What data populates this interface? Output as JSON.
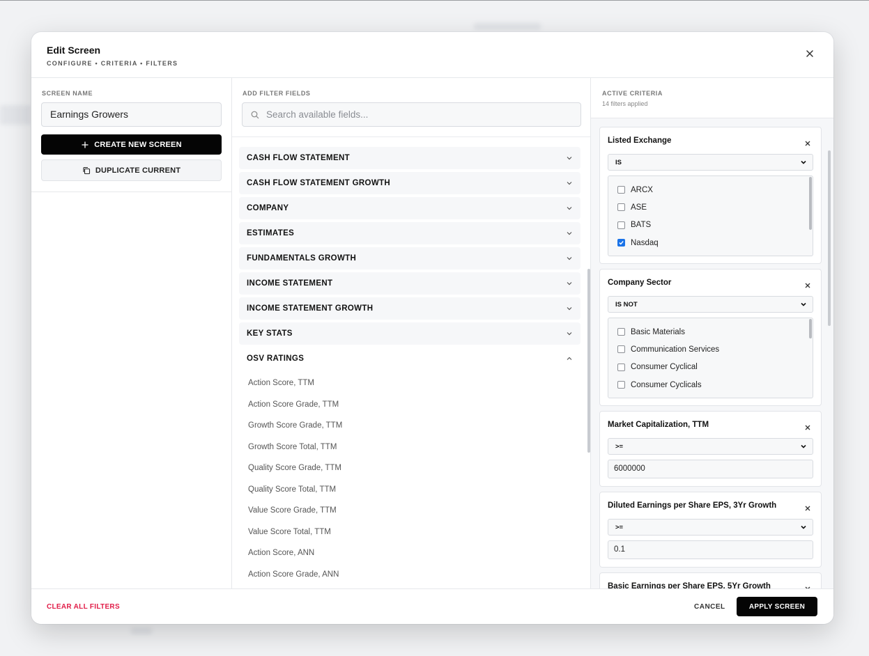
{
  "modal": {
    "title": "Edit Screen",
    "subtitle": "CONFIGURE • CRITERIA • FILTERS"
  },
  "left": {
    "label": "SCREEN NAME",
    "name_value": "Earnings Growers",
    "create_label": "CREATE NEW SCREEN",
    "duplicate_label": "DUPLICATE CURRENT"
  },
  "middle": {
    "label": "ADD FILTER FIELDS",
    "search_placeholder": "Search available fields...",
    "categories": [
      "CASH FLOW STATEMENT",
      "CASH FLOW STATEMENT GROWTH",
      "COMPANY",
      "ESTIMATES",
      "FUNDAMENTALS GROWTH",
      "INCOME STATEMENT",
      "INCOME STATEMENT GROWTH",
      "KEY STATS",
      "OSV RATINGS"
    ],
    "osv_fields": [
      "Action Score, TTM",
      "Action Score Grade, TTM",
      "Growth Score Grade, TTM",
      "Growth Score Total, TTM",
      "Quality Score Grade, TTM",
      "Quality Score Total, TTM",
      "Value Score Grade, TTM",
      "Value Score Total, TTM",
      "Action Score, ANN",
      "Action Score Grade, ANN"
    ]
  },
  "right": {
    "label": "ACTIVE CRITERIA",
    "count": "14 filters applied",
    "filters": [
      {
        "title": "Listed Exchange",
        "operator": "IS",
        "options": [
          {
            "label": "ARCX",
            "checked": false
          },
          {
            "label": "ASE",
            "checked": false
          },
          {
            "label": "BATS",
            "checked": false
          },
          {
            "label": "Nasdaq",
            "checked": true
          }
        ]
      },
      {
        "title": "Company Sector",
        "operator": "IS NOT",
        "options": [
          {
            "label": "Basic Materials",
            "checked": false
          },
          {
            "label": "Communication Services",
            "checked": false
          },
          {
            "label": "Consumer Cyclical",
            "checked": false
          },
          {
            "label": "Consumer Cyclicals",
            "checked": false
          }
        ]
      },
      {
        "title": "Market Capitalization, TTM",
        "operator": ">=",
        "value": "6000000"
      },
      {
        "title": "Diluted Earnings per Share EPS, 3Yr Growth",
        "operator": ">=",
        "value": "0.1"
      },
      {
        "title": "Basic Earnings per Share EPS, 5Yr Growth"
      }
    ]
  },
  "footer": {
    "clear_label": "CLEAR ALL FILTERS",
    "cancel_label": "CANCEL",
    "apply_label": "APPLY SCREEN"
  },
  "colors": {
    "primary": "#050505",
    "danger": "#e11d48",
    "checkbox_checked": "#1a73e8"
  },
  "icons": [
    "close-icon",
    "plus-icon",
    "copy-icon",
    "search-icon",
    "chevron-down-icon",
    "chevron-up-icon",
    "check-icon"
  ]
}
